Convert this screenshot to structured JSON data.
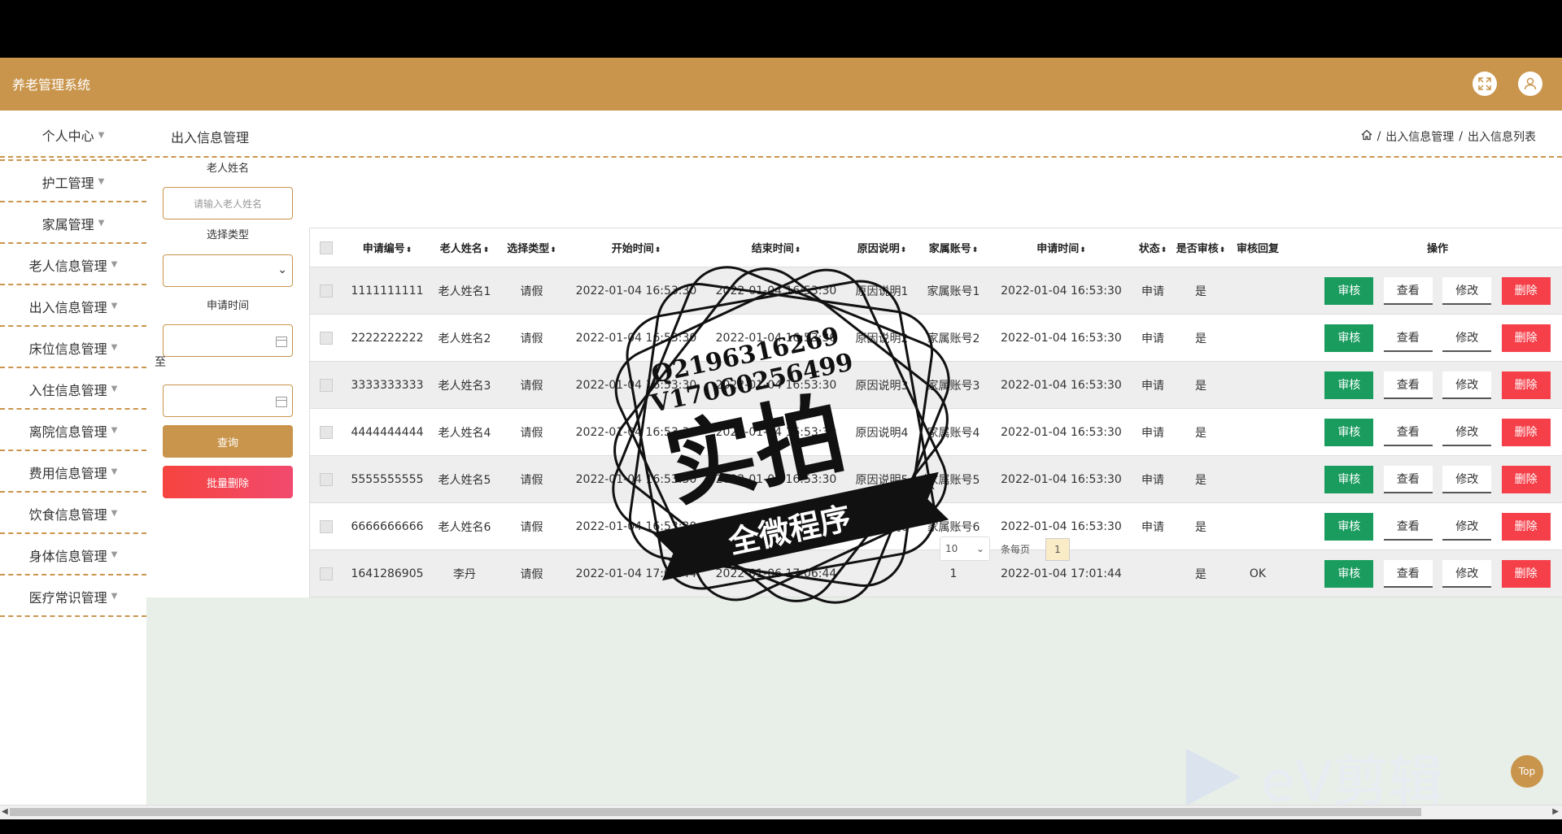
{
  "app": {
    "title": "养老管理系统"
  },
  "sidebar": {
    "items": [
      {
        "label": "个人中心"
      },
      {
        "label": "护工管理"
      },
      {
        "label": "家属管理"
      },
      {
        "label": "老人信息管理"
      },
      {
        "label": "出入信息管理"
      },
      {
        "label": "床位信息管理"
      },
      {
        "label": "入住信息管理"
      },
      {
        "label": "离院信息管理"
      },
      {
        "label": "费用信息管理"
      },
      {
        "label": "饮食信息管理"
      },
      {
        "label": "身体信息管理"
      },
      {
        "label": "医疗常识管理"
      }
    ]
  },
  "page": {
    "title": "出入信息管理",
    "breadcrumb": [
      "出入信息管理",
      "出入信息列表"
    ],
    "breadcrumb_sep": "/"
  },
  "search": {
    "name_label": "老人姓名",
    "name_placeholder": "请输入老人姓名",
    "type_label": "选择类型",
    "time_label": "申请时间",
    "to_label": "至",
    "query_button": "查询",
    "batch_delete_button": "批量删除"
  },
  "table": {
    "headers": [
      "申请编号",
      "老人姓名",
      "选择类型",
      "开始时间",
      "结束时间",
      "原因说明",
      "家属账号",
      "申请时间",
      "状态",
      "是否审核",
      "审核回复",
      "操作"
    ],
    "actions": {
      "audit": "审核",
      "view": "查看",
      "edit": "修改",
      "delete": "删除"
    },
    "rows": [
      [
        "1111111111",
        "老人姓名1",
        "请假",
        "2022-01-04 16:53:30",
        "2022-01-04 16:53:30",
        "原因说明1",
        "家属账号1",
        "2022-01-04 16:53:30",
        "申请",
        "是",
        ""
      ],
      [
        "2222222222",
        "老人姓名2",
        "请假",
        "2022-01-04 16:53:30",
        "2022-01-04 16:53:30",
        "原因说明2",
        "家属账号2",
        "2022-01-04 16:53:30",
        "申请",
        "是",
        ""
      ],
      [
        "3333333333",
        "老人姓名3",
        "请假",
        "2022-01-04 16:53:30",
        "2022-01-04 16:53:30",
        "原因说明3",
        "家属账号3",
        "2022-01-04 16:53:30",
        "申请",
        "是",
        ""
      ],
      [
        "4444444444",
        "老人姓名4",
        "请假",
        "2022-01-04 16:53:30",
        "2022-01-04 16:53:30",
        "原因说明4",
        "家属账号4",
        "2022-01-04 16:53:30",
        "申请",
        "是",
        ""
      ],
      [
        "5555555555",
        "老人姓名5",
        "请假",
        "2022-01-04 16:53:30",
        "2022-01-04 16:53:30",
        "原因说明5",
        "家属账号5",
        "2022-01-04 16:53:30",
        "申请",
        "是",
        ""
      ],
      [
        "6666666666",
        "老人姓名6",
        "请假",
        "2022-01-04 16:53:30",
        "2022-01-04 16:53:30",
        "原因说明6",
        "家属账号6",
        "2022-01-04 16:53:30",
        "申请",
        "是",
        ""
      ],
      [
        "1641286905",
        "李丹",
        "请假",
        "2022-01-04 17:01:44",
        "2022-01-06 17:06:44",
        "",
        "1",
        "2022-01-04 17:01:44",
        "",
        "是",
        "OK"
      ]
    ]
  },
  "pagination": {
    "page_size": "10",
    "per_page_label": "条每页",
    "current_page": "1"
  },
  "top_button": "Top",
  "watermark": {
    "stamp_line1": "Q2196316269",
    "stamp_line2": "V17060256499",
    "stamp_main": "实拍",
    "stamp_banner": "全微程序",
    "ev_text": "eV剪辑"
  },
  "colors": {
    "brand": "#c9954c",
    "audit": "#1a9c5f",
    "delete": "#f5404a"
  },
  "icons": {
    "fullscreen": "fullscreen-icon",
    "user": "user-icon",
    "home": "home-icon"
  }
}
